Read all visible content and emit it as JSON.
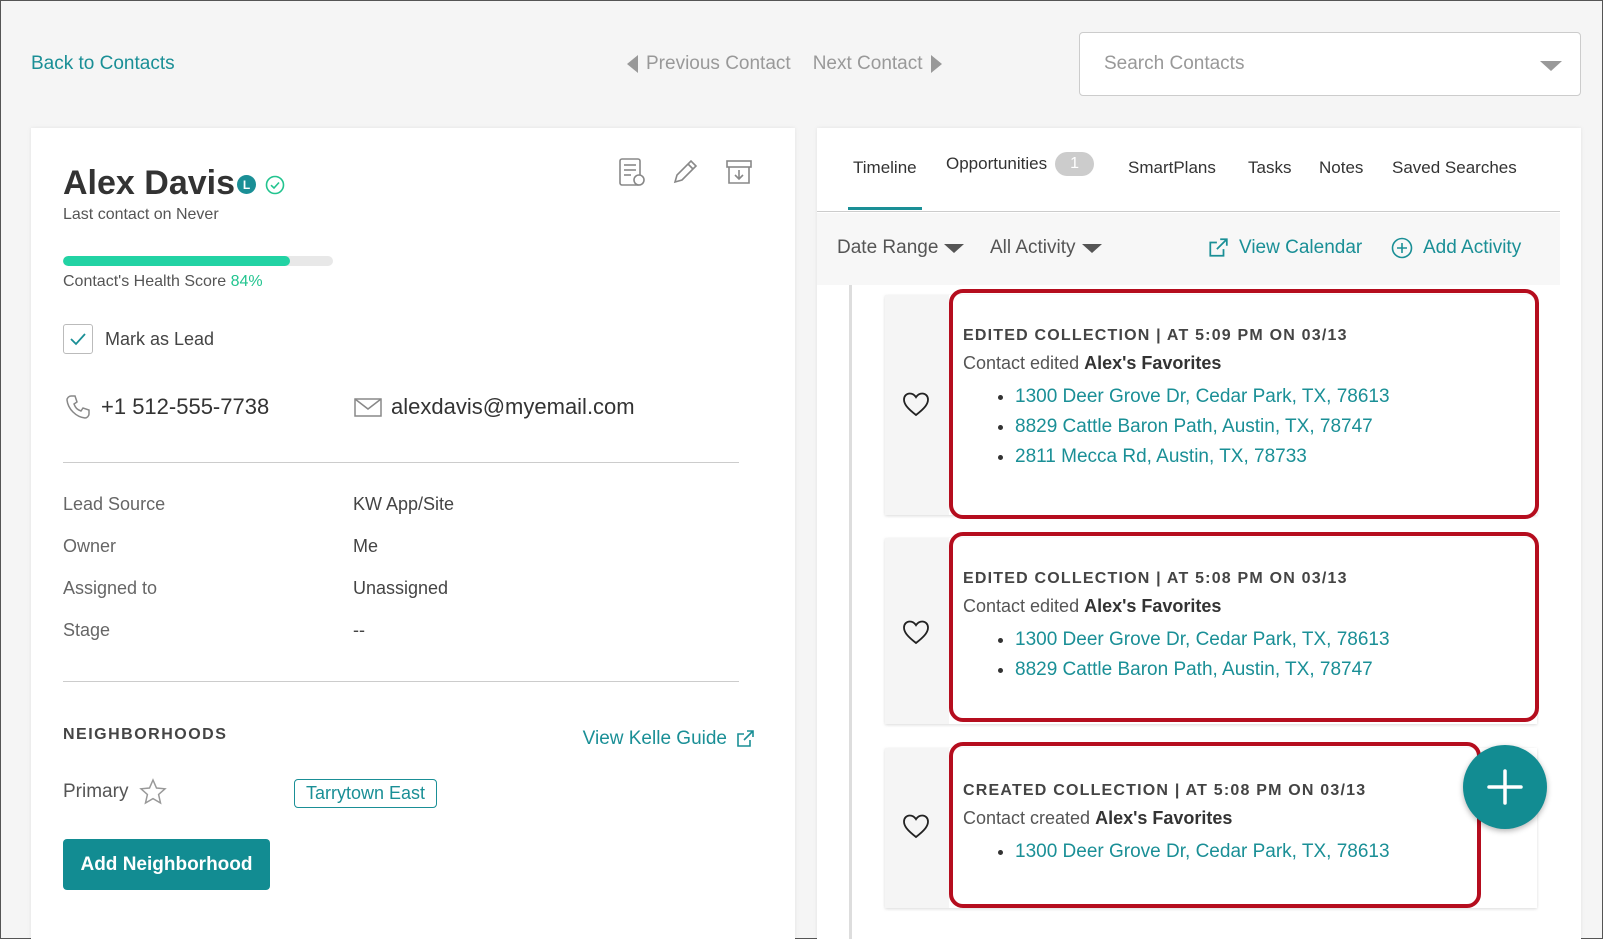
{
  "top": {
    "back_label": "Back to Contacts",
    "prev_label": "Previous Contact",
    "next_label": "Next Contact",
    "search_placeholder": "Search Contacts"
  },
  "contact": {
    "name": "Alex Davis",
    "badge": "L",
    "last_contact": "Last contact on Never",
    "health_label": "Contact's Health Score",
    "health_value": "84%",
    "health_fraction": 0.84,
    "lead_label": "Mark as Lead",
    "lead_checked": true,
    "phone": "+1 512-555-7738",
    "email": "alexdavis@myemail.com"
  },
  "details": [
    {
      "label": "Lead Source",
      "value": "KW App/Site"
    },
    {
      "label": "Owner",
      "value": "Me"
    },
    {
      "label": "Assigned to",
      "value": "Unassigned"
    },
    {
      "label": "Stage",
      "value": "--"
    }
  ],
  "neighborhoods": {
    "title": "NEIGHBORHOODS",
    "guide_label": "View Kelle Guide",
    "primary_label": "Primary",
    "tag": "Tarrytown East",
    "add_button": "Add Neighborhood"
  },
  "tabs": [
    {
      "label": "Timeline",
      "active": true
    },
    {
      "label": "Opportunities",
      "count": "1"
    },
    {
      "label": "SmartPlans"
    },
    {
      "label": "Tasks"
    },
    {
      "label": "Notes"
    },
    {
      "label": "Saved Searches"
    }
  ],
  "filters": {
    "date_range": "Date Range",
    "all_activity": "All Activity",
    "view_calendar": "View Calendar",
    "add_activity": "Add Activity"
  },
  "events": [
    {
      "title": "EDITED COLLECTION | AT 5:09 PM ON 03/13",
      "desc_prefix": "Contact edited",
      "desc_bold": "Alex's Favorites",
      "items": [
        "1300 Deer Grove Dr, Cedar Park, TX, 78613",
        "8829 Cattle Baron Path, Austin, TX, 78747",
        "2811 Mecca Rd, Austin, TX, 78733"
      ]
    },
    {
      "title": "EDITED COLLECTION | AT 5:08 PM ON 03/13",
      "desc_prefix": "Contact edited",
      "desc_bold": "Alex's Favorites",
      "items": [
        "1300 Deer Grove Dr, Cedar Park, TX, 78613",
        "8829 Cattle Baron Path, Austin, TX, 78747"
      ]
    },
    {
      "title": "CREATED COLLECTION | AT 5:08 PM ON 03/13",
      "desc_prefix": "Contact created",
      "desc_bold": "Alex's Favorites",
      "items": [
        "1300 Deer Grove Dr, Cedar Park, TX, 78613"
      ]
    }
  ],
  "colors": {
    "accent": "#1a8f96",
    "health": "#22d3a4",
    "highlight": "#b50d1e"
  }
}
